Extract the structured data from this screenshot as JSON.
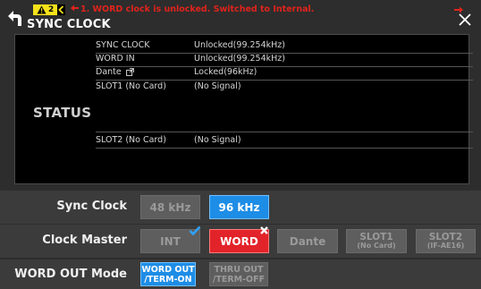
{
  "window": {
    "title": "SYNC CLOCK"
  },
  "annotation": {
    "warn_count": "2",
    "message": "1. WORD clock is unlocked.  Switched to Internal.",
    "color": "#e0231c",
    "badge_color": "#f6e21a"
  },
  "status": {
    "heading": "STATUS",
    "rows": [
      {
        "key": "SYNC CLOCK",
        "value": "Unlocked(99.254kHz)"
      },
      {
        "key": "WORD IN",
        "value": "Unlocked(99.254kHz)"
      },
      {
        "key": "Dante",
        "value": "Locked(96kHz)",
        "icon": "external-link-icon"
      },
      {
        "key": "SLOT1 (No Card)",
        "value": "(No Signal)"
      },
      {
        "key": "SLOT2 (No Card)",
        "value": "(No Signal)"
      }
    ]
  },
  "sync_clock": {
    "label": "Sync Clock",
    "options": [
      "48 kHz",
      "96 kHz"
    ],
    "selected": "96 kHz"
  },
  "clock_master": {
    "label": "Clock Master",
    "options": {
      "int": "INT",
      "word": "WORD",
      "dante": "Dante",
      "slot1": "SLOT1",
      "slot1_sub": "(No Card)",
      "slot2": "SLOT2",
      "slot2_sub": "(IF-AE16)"
    },
    "current_source": "INT",
    "selected_unlocked": "WORD"
  },
  "word_out": {
    "label": "WORD OUT Mode",
    "opt1_line1": "WORD OUT",
    "opt1_line2": "/TERM-ON",
    "opt2_line1": "THRU OUT",
    "opt2_line2": "/TERM-OFF",
    "selected": "WORD OUT /TERM-ON"
  },
  "colors": {
    "selected_blue": "#1e8de6",
    "error_red": "#e2232a",
    "background": "#2d2d2d"
  }
}
